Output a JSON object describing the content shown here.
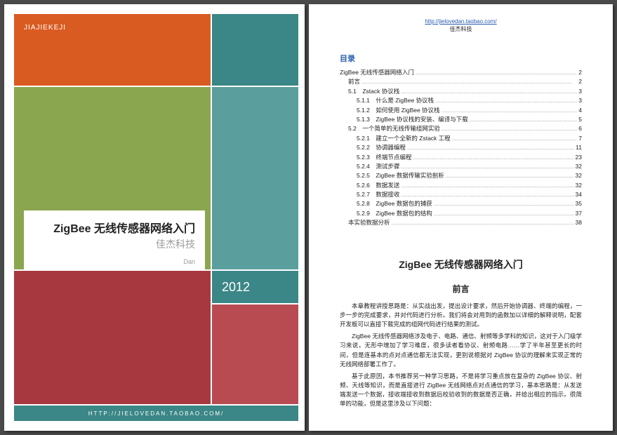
{
  "cover": {
    "header_label": "JIAJIEKEJI",
    "title": "ZigBee 无线传感器网络入门",
    "subtitle": "佳杰科技",
    "author": "Dan",
    "year": "2012",
    "footer": "HTTP://JIELOVEDAN.TAOBAO.COM/"
  },
  "page2": {
    "link": "http://jielovedan.taobao.com/",
    "brand": "佳杰科技",
    "toc_heading": "目录",
    "toc": [
      {
        "lv": 0,
        "label": "ZigBee 无线传感器网络入门",
        "pg": "2"
      },
      {
        "lv": 1,
        "label": "前言",
        "pg": "2"
      },
      {
        "lv": 1,
        "label": "5.1　Zstack 协议栈",
        "pg": "3"
      },
      {
        "lv": 2,
        "label": "5.1.1　什么是 ZigBee 协议栈",
        "pg": "3"
      },
      {
        "lv": 2,
        "label": "5.1.2　如何使用 ZigBee 协议栈",
        "pg": "4"
      },
      {
        "lv": 2,
        "label": "5.1.3　ZigBee 协议栈的安装、编译与下载",
        "pg": "5"
      },
      {
        "lv": 1,
        "label": "5.2　一个简单的无线传输组网实验",
        "pg": "6"
      },
      {
        "lv": 2,
        "label": "5.2.1　建立一个全新的 Zstack 工程",
        "pg": "7"
      },
      {
        "lv": 2,
        "label": "5.2.2　协调器编程",
        "pg": "11"
      },
      {
        "lv": 2,
        "label": "5.2.3　终端节点编程",
        "pg": "23"
      },
      {
        "lv": 2,
        "label": "5.2.4　测试步骤",
        "pg": "32"
      },
      {
        "lv": 2,
        "label": "5.2.5　ZigBee 数据传输实验剖析",
        "pg": "32"
      },
      {
        "lv": 2,
        "label": "5.2.6　数据发送",
        "pg": "32"
      },
      {
        "lv": 2,
        "label": "5.2.7　数据接收",
        "pg": "34"
      },
      {
        "lv": 2,
        "label": "5.2.8　ZigBee 数据包的捕获",
        "pg": "35"
      },
      {
        "lv": 2,
        "label": "5.2.9　ZigBee 数据包的结构",
        "pg": "37"
      },
      {
        "lv": 1,
        "label": "本实验数据分析",
        "pg": "38"
      }
    ],
    "body_title": "ZigBee 无线传感器网络入门",
    "body_subtitle": "前言",
    "para1": "本章教程讲授思路是：从实战出发，提出设计要求，然后开始协调器、终端的编程，一步一步的完成要求，并对代码进行分析。我们将会对用到的函数加以详细的解释说明，配套开发板可以直接下载完成的组网代码进行结果的测试。",
    "para2": "ZigBee 无线传感器网络涉及电子、电路、通信、射频等多学科的知识，这对于入门级学习来说，无形中增加了学习难度，很多读者看协议、射频电路……学了半年甚至更长的时间，但是连基本的点对点通信都无法实现，更别说根据对 ZigBee 协议的理解来实现正常的无线网络部署工作了。",
    "para3": "基于此原因，本书推荐另一种学习思路，不是将学习重点放在复杂的 ZigBee 协议、射频、天线等知识，而是直接进行 ZigBee 无线网络点对点通信的学习，基本思路是：从发送端发送一个数据，接收端接收到数据后校验收到的数据是否正确，并给出相应的指示。很简单的功能，但是这里涉及以下问题："
  }
}
